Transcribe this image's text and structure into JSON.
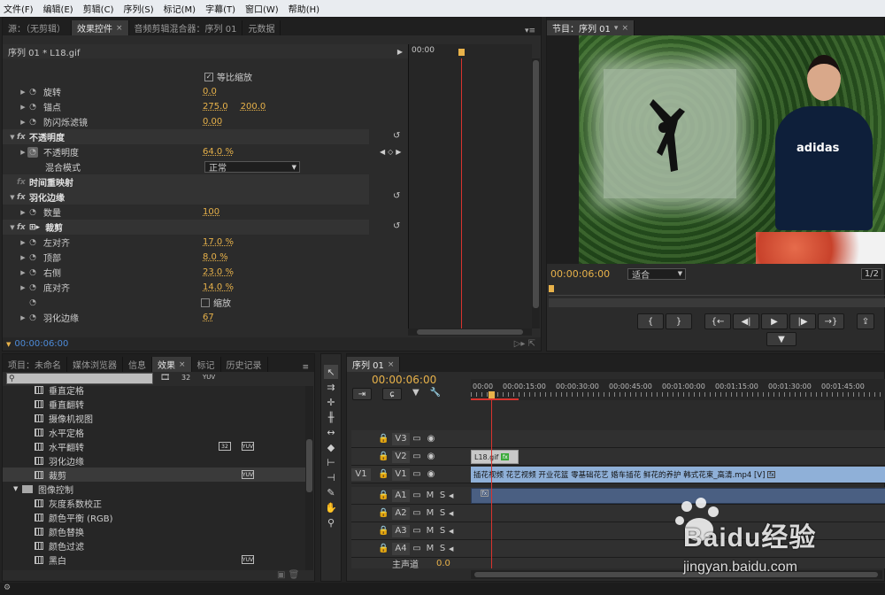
{
  "menu": [
    "文件(F)",
    "编辑(E)",
    "剪辑(C)",
    "序列(S)",
    "标记(M)",
    "字幕(T)",
    "窗口(W)",
    "帮助(H)"
  ],
  "source_panel": {
    "tabs": [
      "源：（无剪辑）",
      "效果控件",
      "音频剪辑混合器：序列 01",
      "元数据"
    ],
    "clip_label": "序列 01 * L18.gif",
    "timecode_ruler": "00:00",
    "rows": {
      "uniform_scale": "等比缩放",
      "rotation": "旋转",
      "rotation_val": "0.0",
      "anchor": "锚点",
      "anchor_x": "275.0",
      "anchor_y": "200.0",
      "flicker": "防闪烁滤镜",
      "flicker_val": "0.00",
      "opacity_sect": "不透明度",
      "opacity": "不透明度",
      "opacity_val": "64.0 %",
      "blend": "混合模式",
      "blend_val": "正常",
      "time_remap": "时间重映射",
      "feather_sect": "羽化边缘",
      "amount": "数量",
      "amount_val": "100",
      "crop_sect": "裁剪",
      "left": "左对齐",
      "left_val": "17.0 %",
      "top": "顶部",
      "top_val": "8.0 %",
      "right": "右侧",
      "right_val": "23.0 %",
      "bottom": "底对齐",
      "bottom_val": "14.0 %",
      "zoom": "缩放",
      "feather": "羽化边缘",
      "feather_val": "67"
    },
    "bottom_timecode": "00:00:06:00"
  },
  "program_panel": {
    "tab": "节目：序列 01",
    "timecode": "00:00:06:00",
    "fit": "适合",
    "ratio": "1/2",
    "shirt_text": "adidas"
  },
  "effects_panel": {
    "tabs": [
      "项目：未命名",
      "媒体浏览器",
      "信息",
      "效果",
      "标记",
      "历史记录"
    ],
    "items": [
      "垂直定格",
      "垂直翻转",
      "摄像机视图",
      "水平定格",
      "水平翻转",
      "羽化边缘",
      "裁剪"
    ],
    "folder": "图像控制",
    "sub_items": [
      "灰度系数校正",
      "颜色平衡 (RGB)",
      "颜色替换",
      "颜色过滤",
      "黑白"
    ],
    "badge_32": "32",
    "badge_yuv": "YUV"
  },
  "timeline": {
    "tab": "序列 01",
    "timecode": "00:00:06:00",
    "ruler": [
      "00:00",
      "00:00:15:00",
      "00:00:30:00",
      "00:00:45:00",
      "00:01:00:00",
      "00:01:15:00",
      "00:01:30:00",
      "00:01:45:00"
    ],
    "video_tracks": [
      "V3",
      "V2",
      "V1"
    ],
    "src_v1": "V1",
    "audio_tracks": [
      "A1",
      "A2",
      "A3",
      "A4"
    ],
    "master": "主声道",
    "master_val": "0.0",
    "clip_gif": "L18.gif",
    "clip_main": "插花视频 花艺视频 开业花篮 零基础花艺 婚车插花 鲜花的养护 韩式花束_高清.mp4 [V]",
    "m": "M",
    "s": "S"
  },
  "watermark": {
    "brand": "Baidu经验",
    "url": "jingyan.baidu.com"
  },
  "colors": {
    "accent": "#e8b24a",
    "playhead": "#d8342e",
    "clip_blue": "#8fb0d8",
    "clip_v2": "#c8c8c8"
  }
}
